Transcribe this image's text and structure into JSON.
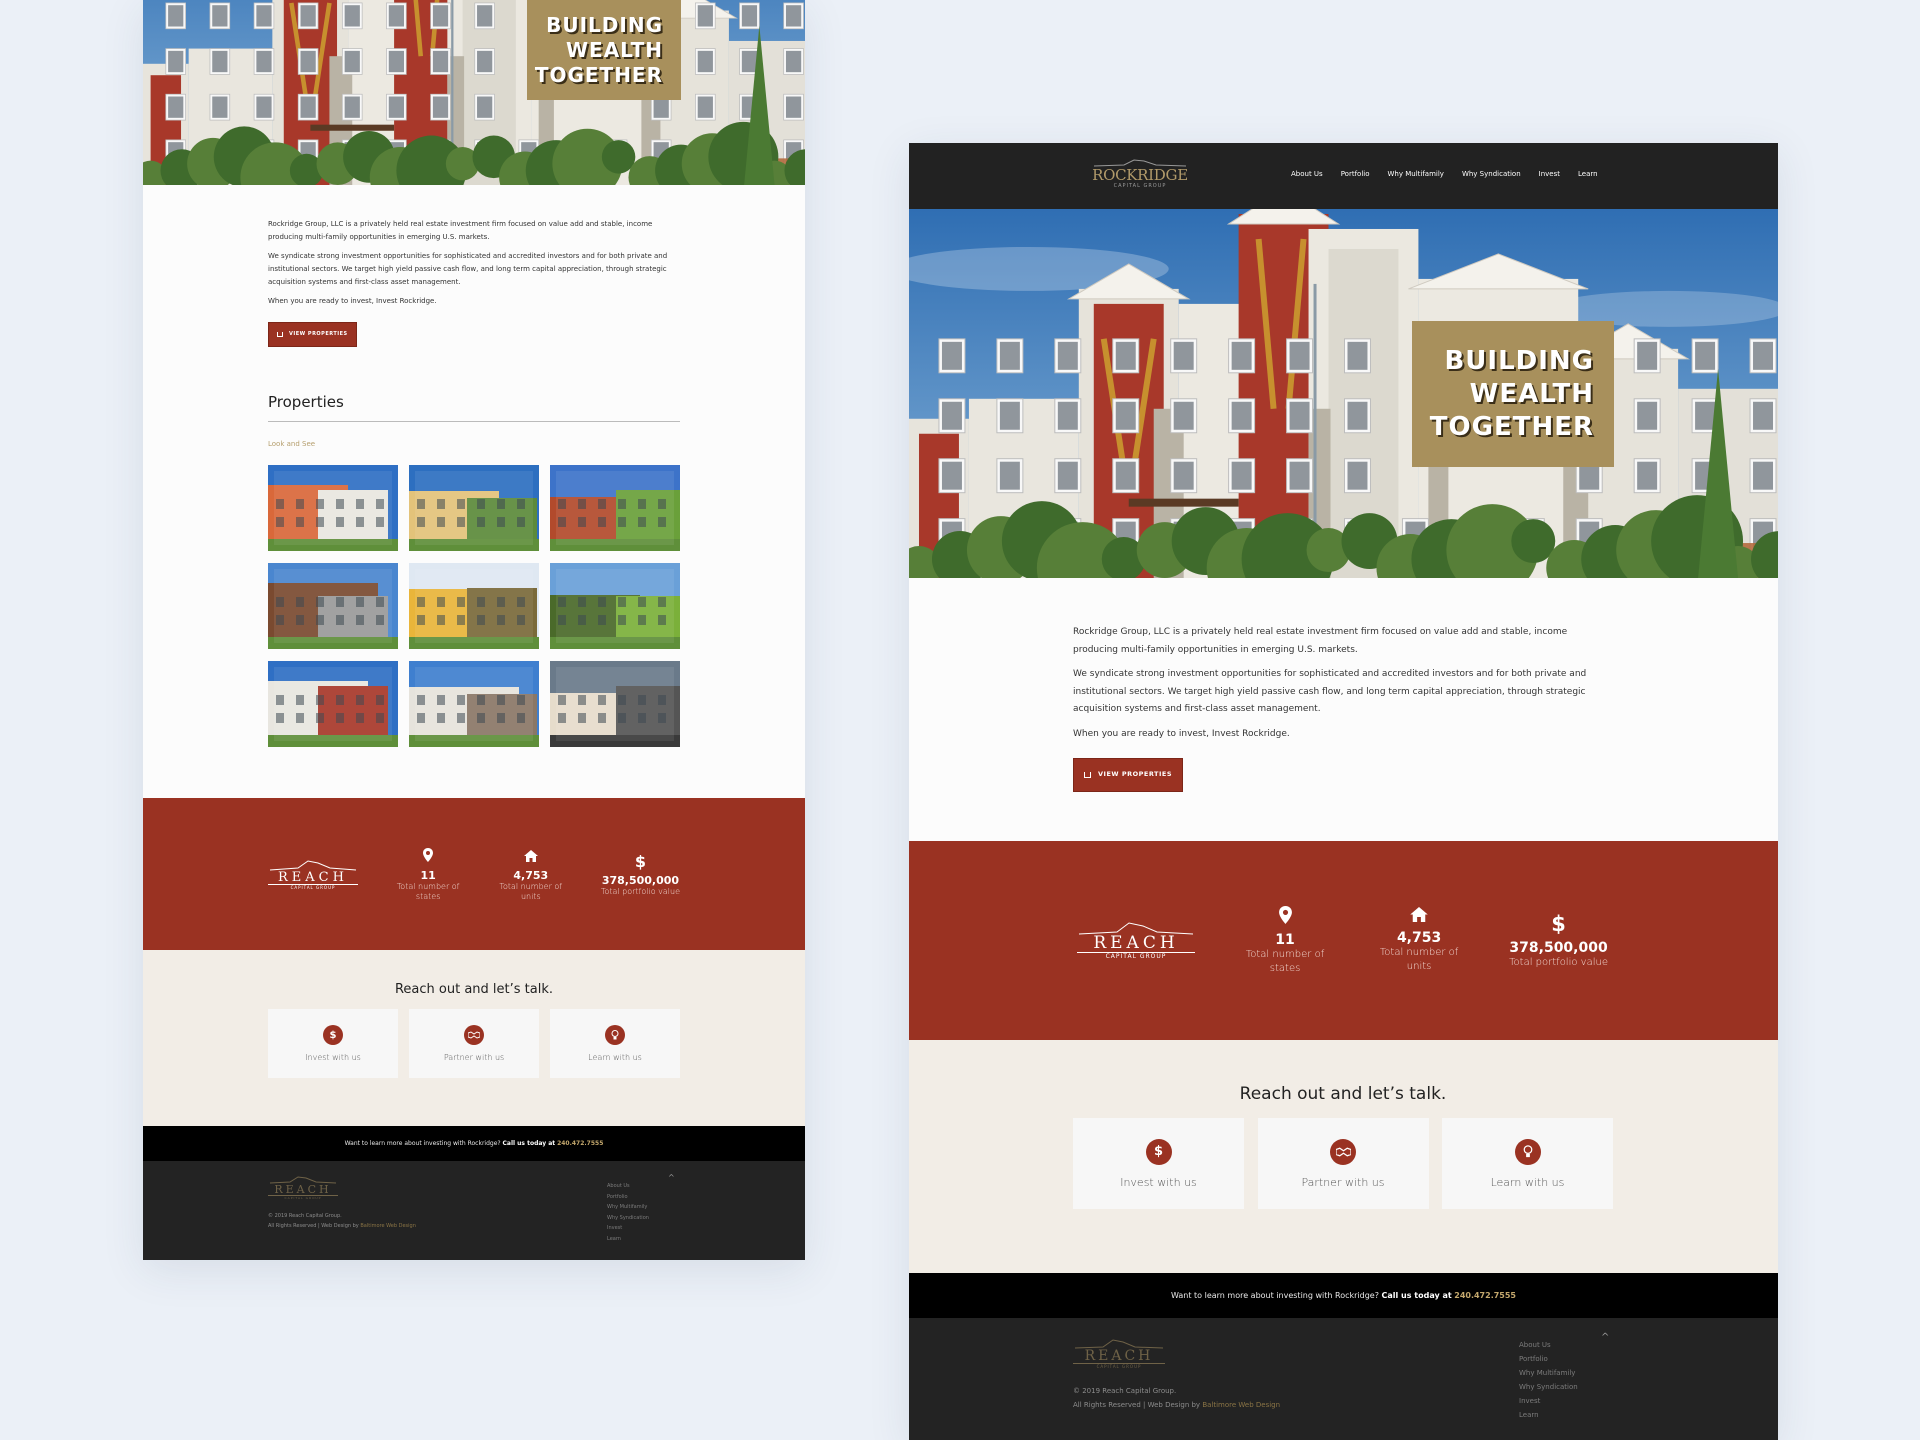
{
  "brand": {
    "name": "ROCKRIDGE",
    "sub": "CAPITAL GROUP",
    "reach_name": "REACH",
    "reach_sub": "CAPITAL GROUP"
  },
  "nav": {
    "items": [
      "About Us",
      "Portfolio",
      "Why Multifamily",
      "Why Syndication",
      "Invest",
      "Learn"
    ]
  },
  "hero": {
    "lines": [
      "BUILDING",
      "WEALTH",
      "TOGETHER"
    ]
  },
  "intro": {
    "paragraphs": [
      "Rockridge Group, LLC is a privately held real estate investment firm focused on value add and stable, income producing multi-family opportunities in emerging U.S. markets.",
      "We syndicate strong investment opportunities for sophisticated and accredited investors and for both private and institutional sectors. We target high yield passive cash flow, and long term capital appreciation, through strategic acquisition systems and first-class asset management.",
      "When you are ready to invest, Invest Rockridge."
    ],
    "button_label": "VIEW PROPERTIES"
  },
  "properties": {
    "title": "Properties",
    "subtitle": "Look and See",
    "images": [
      "property-brick-modern",
      "property-tan-stucco",
      "property-townhomes-lawn",
      "property-brown-wood",
      "property-autumn-gazebo",
      "property-trees-lawn",
      "property-red-white",
      "property-gray-highrise",
      "property-beige-garages"
    ]
  },
  "stats": [
    {
      "icon": "map-pin-icon",
      "value": "11",
      "label": "Total number of states"
    },
    {
      "icon": "house-icon",
      "value": "4,753",
      "label": "Total number of units"
    },
    {
      "icon": "dollar-icon",
      "value": "378,500,000",
      "label": "Total portfolio value"
    }
  ],
  "contact": {
    "title": "Reach out and let’s talk.",
    "cards": [
      {
        "icon": "dollar-icon",
        "label": "Invest with us"
      },
      {
        "icon": "handshake-icon",
        "label": "Partner with us"
      },
      {
        "icon": "lightbulb-icon",
        "label": "Learn with us"
      }
    ]
  },
  "callbar": {
    "text": "Want to learn more about investing with Rockridge?",
    "bold": "Call us today at",
    "phone": "240.472.7555"
  },
  "footer": {
    "copyright": "© 2019 Reach Capital Group.",
    "rights": "All Rights Reserved | Web Design by",
    "designer": "Baltimore Web Design",
    "links": [
      "About Us",
      "Portfolio",
      "Why Multifamily",
      "Why Syndication",
      "Invest",
      "Learn"
    ],
    "back_to_top": "^"
  },
  "colors": {
    "accent_red": "#9a3222",
    "gold": "#a8905c",
    "cream": "#f2ede6",
    "dark": "#232323",
    "background": "#ebf0f7"
  }
}
